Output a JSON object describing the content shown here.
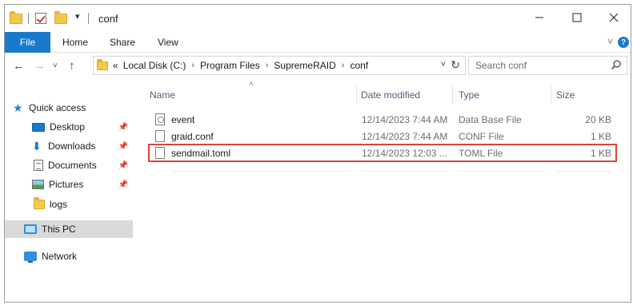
{
  "title": "conf",
  "ribbon": {
    "file": "File",
    "home": "Home",
    "share": "Share",
    "view": "View"
  },
  "address": {
    "prefix": "«",
    "crumbs": [
      "Local Disk (C:)",
      "Program Files",
      "SupremeRAID",
      "conf"
    ]
  },
  "search": {
    "placeholder": "Search conf"
  },
  "navpane": {
    "quick_access": "Quick access",
    "items": [
      {
        "label": "Desktop",
        "icon": "desktop-icon",
        "pinned": true
      },
      {
        "label": "Downloads",
        "icon": "download-arrow-icon",
        "pinned": true
      },
      {
        "label": "Documents",
        "icon": "document-icon",
        "pinned": true
      },
      {
        "label": "Pictures",
        "icon": "pictures-icon",
        "pinned": true
      },
      {
        "label": "logs",
        "icon": "folder-icon",
        "pinned": false
      }
    ],
    "this_pc": "This PC",
    "network": "Network"
  },
  "columns": {
    "name": "Name",
    "date": "Date modified",
    "type": "Type",
    "size": "Size"
  },
  "files": [
    {
      "name": "event",
      "date": "12/14/2023 7:44 AM",
      "type": "Data Base File",
      "size": "20 KB",
      "icon": "database-file-icon"
    },
    {
      "name": "graid.conf",
      "date": "12/14/2023 7:44 AM",
      "type": "CONF File",
      "size": "1 KB",
      "icon": "file-icon"
    },
    {
      "name": "sendmail.toml",
      "date": "12/14/2023 12:03 ...",
      "type": "TOML File",
      "size": "1 KB",
      "icon": "file-icon",
      "highlighted": true
    }
  ],
  "colors": {
    "accent": "#1979ca",
    "highlight": "#d9453a"
  }
}
